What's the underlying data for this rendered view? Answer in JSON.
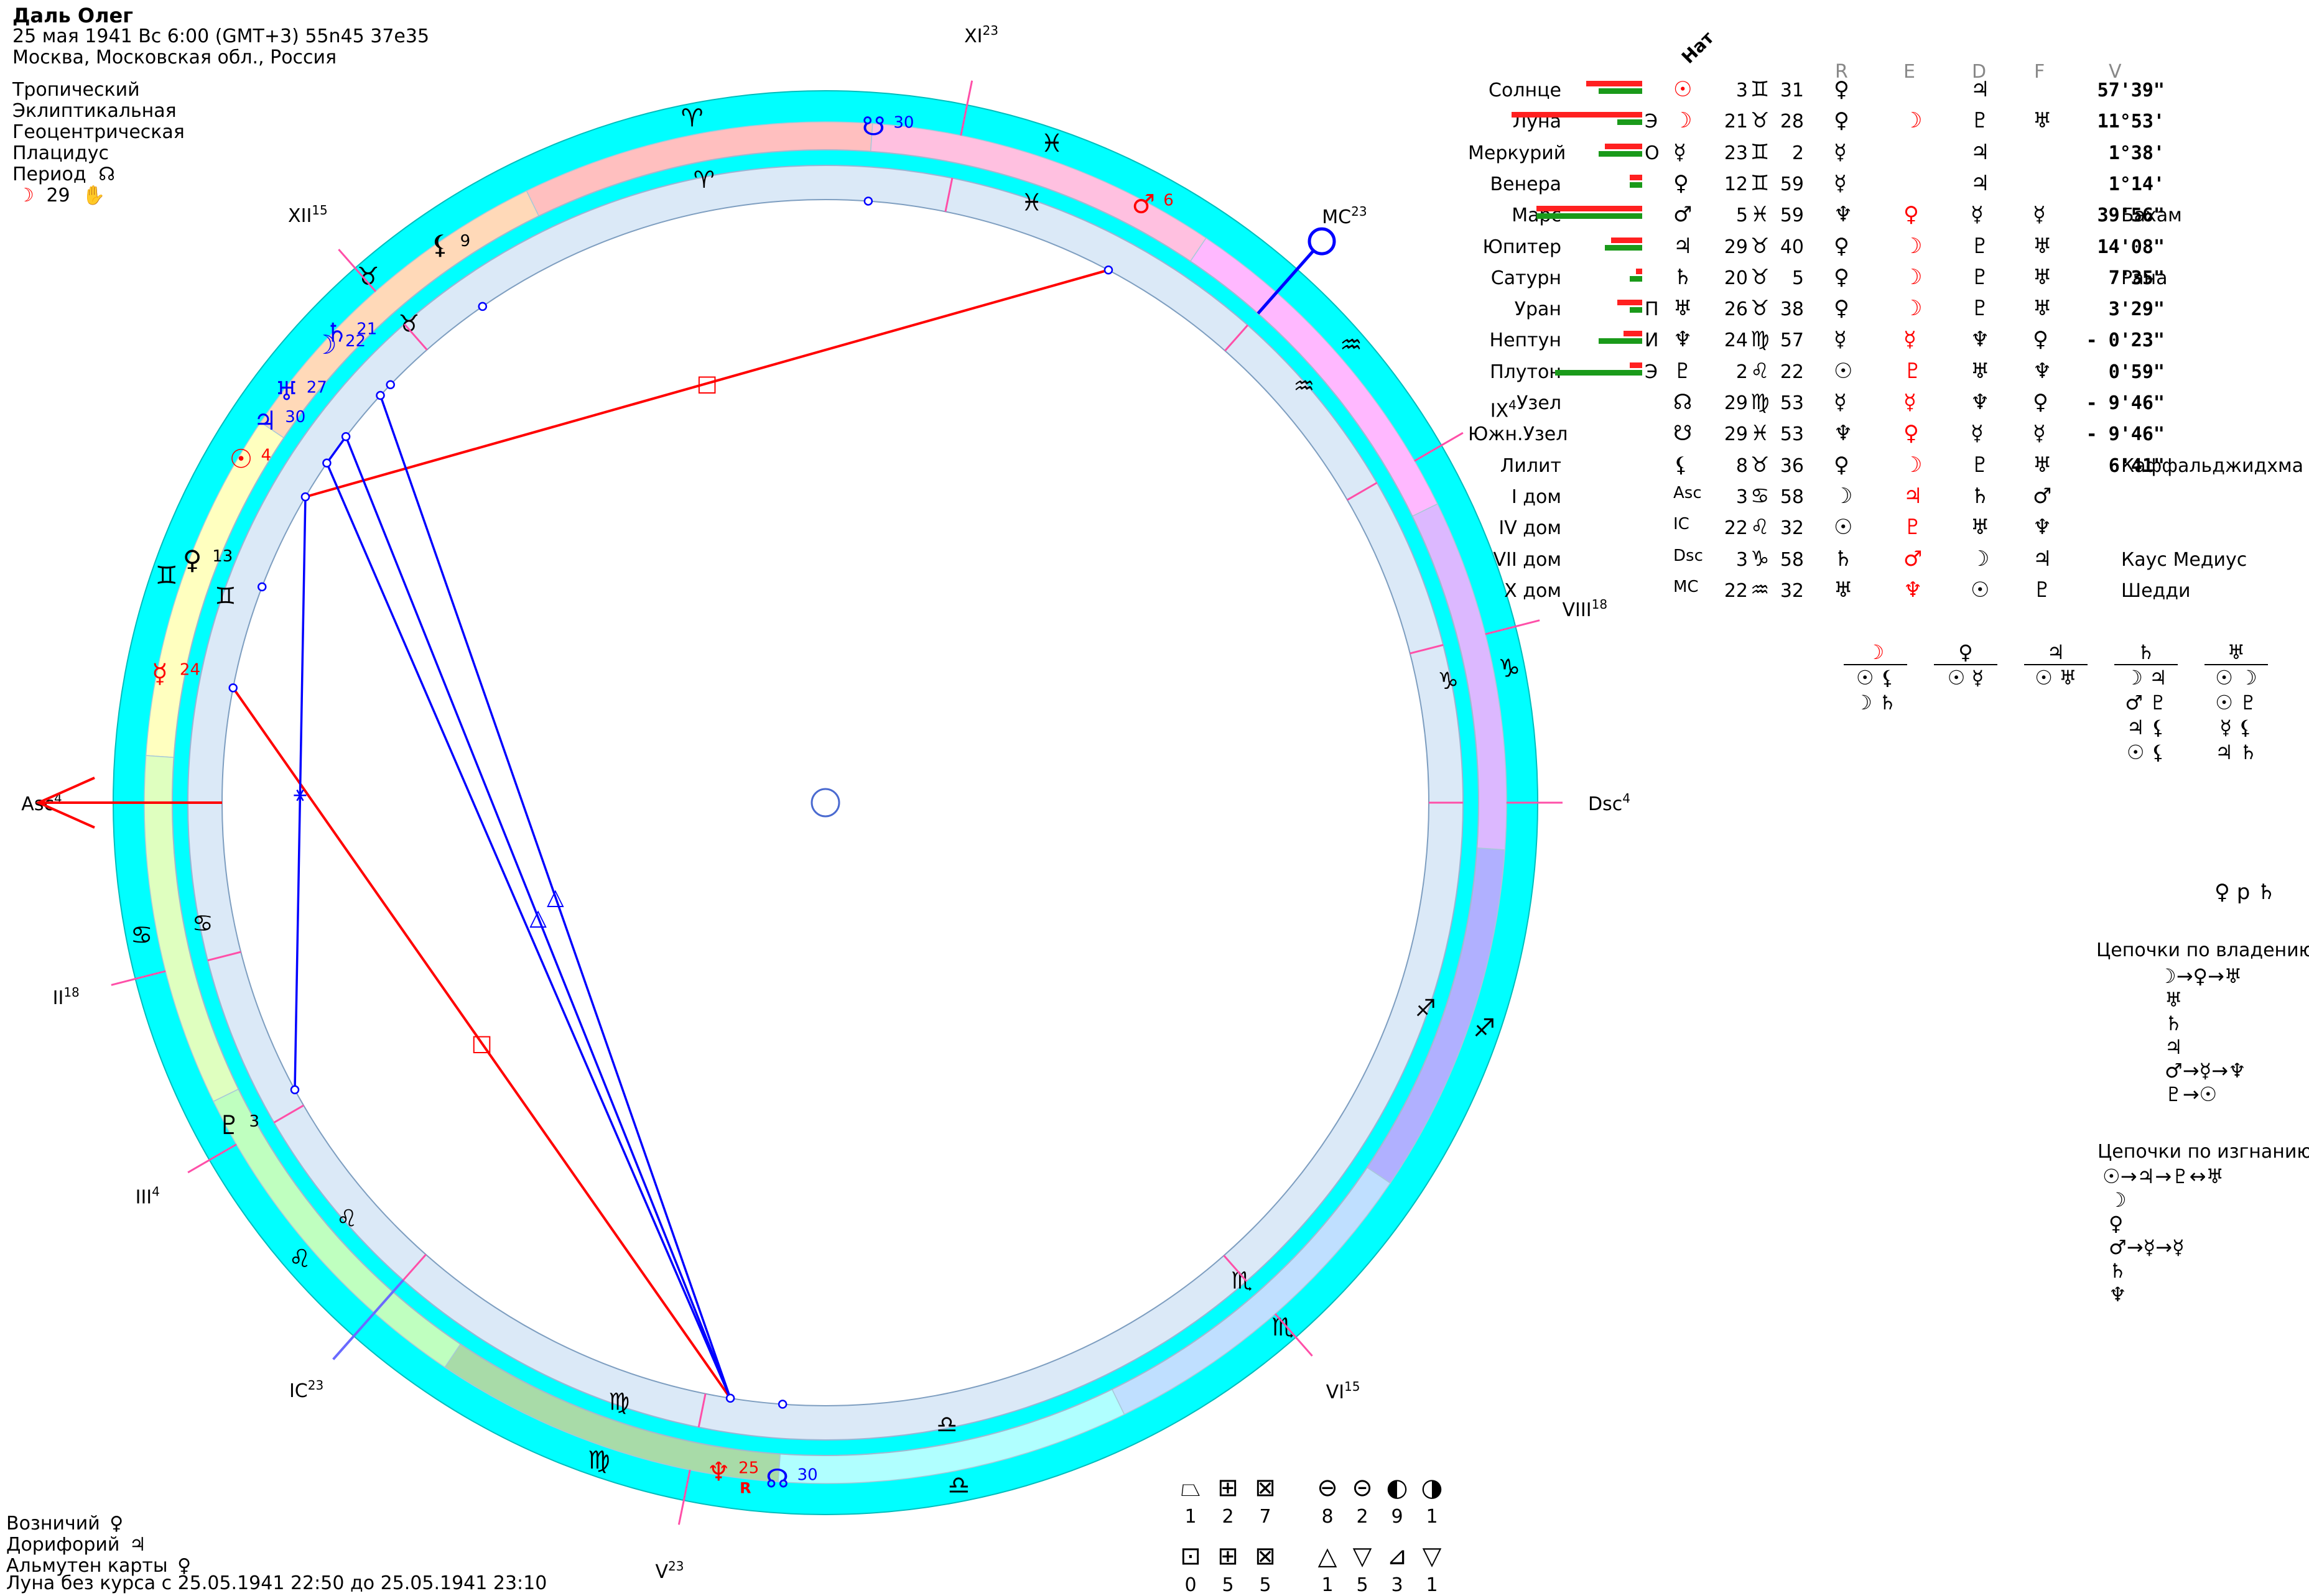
{
  "header": {
    "name": "Даль Олег",
    "line1": "25 мая 1941  Вс   6:00 (GMT+3) 55n45  37e35",
    "line2": "Москва, Московская обл., Россия",
    "settings": [
      "Тропический",
      "Эклиптикальная",
      "Геоцентрическая",
      "Плацидус"
    ],
    "period_label": "Период",
    "period_symbol": "☊",
    "period_moon": "☽",
    "period_value": "29",
    "period_hand": "✋"
  },
  "table": {
    "header_nat": "Нат",
    "col_headers": [
      "R",
      "E",
      "D",
      "F",
      "V"
    ],
    "rows": [
      {
        "name": "Солнце",
        "glyph": "☉",
        "deg": "3",
        "sign": "♊",
        "min": "31",
        "r": "♀",
        "e": "",
        "d": "♃",
        "f": "",
        "v": "57'39\"",
        "note": "",
        "marker": ""
      },
      {
        "name": "Луна",
        "glyph": "☽",
        "deg": "21",
        "sign": "♉",
        "min": "28",
        "r": "♀",
        "e": "☽",
        "d": "♇",
        "f": "♅",
        "v": "11°53'",
        "note": "",
        "marker": "Э"
      },
      {
        "name": "Меркурий",
        "glyph": "☿",
        "deg": "23",
        "sign": "♊",
        "min": "2",
        "r": "☿",
        "e": "",
        "d": "♃",
        "f": "",
        "v": "1°38'",
        "note": "",
        "marker": "О"
      },
      {
        "name": "Венера",
        "glyph": "♀",
        "deg": "12",
        "sign": "♊",
        "min": "59",
        "r": "☿",
        "e": "",
        "d": "♃",
        "f": "",
        "v": "1°14'",
        "note": "",
        "marker": ""
      },
      {
        "name": "Марс",
        "glyph": "♂",
        "deg": "5",
        "sign": "♓",
        "min": "59",
        "r": "♆",
        "e": "♀",
        "d": "☿",
        "f": "☿",
        "v": "39'56\"",
        "note": "Бахам",
        "marker": ""
      },
      {
        "name": "Юпитер",
        "glyph": "♃",
        "deg": "29",
        "sign": "♉",
        "min": "40",
        "r": "♀",
        "e": "☽",
        "d": "♇",
        "f": "♅",
        "v": "14'08\"",
        "note": "",
        "marker": ""
      },
      {
        "name": "Сатурн",
        "glyph": "♄",
        "deg": "20",
        "sign": "♉",
        "min": "5",
        "r": "♀",
        "e": "☽",
        "d": "♇",
        "f": "♅",
        "v": "7'35\"",
        "note": "Рана",
        "marker": ""
      },
      {
        "name": "Уран",
        "glyph": "♅",
        "deg": "26",
        "sign": "♉",
        "min": "38",
        "r": "♀",
        "e": "☽",
        "d": "♇",
        "f": "♅",
        "v": "3'29\"",
        "note": "",
        "marker": "П"
      },
      {
        "name": "Нептун",
        "glyph": "♆",
        "deg": "24",
        "sign": "♍",
        "min": "57",
        "r": "☿",
        "e": "☿",
        "d": "♆",
        "f": "♀",
        "v": "- 0'23\"",
        "note": "",
        "marker": "И"
      },
      {
        "name": "Плутон",
        "glyph": "♇",
        "deg": "2",
        "sign": "♌",
        "min": "22",
        "r": "☉",
        "e": "♇",
        "d": "♅",
        "f": "♆",
        "v": "0'59\"",
        "note": "",
        "marker": "Э"
      },
      {
        "name": "Узел",
        "glyph": "☊",
        "deg": "29",
        "sign": "♍",
        "min": "53",
        "r": "☿",
        "e": "☿",
        "d": "♆",
        "f": "♀",
        "v": "- 9'46\"",
        "note": "",
        "marker": ""
      },
      {
        "name": "Южн.Узел",
        "glyph": "☋",
        "deg": "29",
        "sign": "♓",
        "min": "53",
        "r": "♆",
        "e": "♀",
        "d": "☿",
        "f": "☿",
        "v": "- 9'46\"",
        "note": "",
        "marker": ""
      },
      {
        "name": "Лилит",
        "glyph": "⚸",
        "deg": "8",
        "sign": "♉",
        "min": "36",
        "r": "♀",
        "e": "☽",
        "d": "♇",
        "f": "♅",
        "v": "6'41\"",
        "note": "Каффальджидхма",
        "marker": ""
      },
      {
        "name": "I дом",
        "glyph": "Asc",
        "deg": "3",
        "sign": "♋",
        "min": "58",
        "r": "☽",
        "e": "♃",
        "d": "♄",
        "f": "♂",
        "v": "",
        "note": "",
        "marker": ""
      },
      {
        "name": "IV дом",
        "glyph": "IC",
        "deg": "22",
        "sign": "♌",
        "min": "32",
        "r": "☉",
        "e": "♇",
        "d": "♅",
        "f": "♆",
        "v": "",
        "note": "",
        "marker": ""
      },
      {
        "name": "VII дом",
        "glyph": "Dsc",
        "deg": "3",
        "sign": "♑",
        "min": "58",
        "r": "♄",
        "e": "♂",
        "d": "☽",
        "f": "♃",
        "v": "",
        "note": "Каус Медиус",
        "marker": ""
      },
      {
        "name": "X дом",
        "glyph": "MC",
        "deg": "22",
        "sign": "♒",
        "min": "32",
        "r": "♅",
        "e": "♆",
        "d": "☉",
        "f": "♇",
        "v": "",
        "note": "Шедди",
        "marker": ""
      }
    ]
  },
  "dispositors": [
    {
      "top": "☽",
      "items": [
        "☉ ⚸",
        "☽ ♄"
      ]
    },
    {
      "top": "♀",
      "items": [
        "☉ ☿"
      ]
    },
    {
      "top": "♃",
      "items": [
        "☉ ♅"
      ]
    },
    {
      "top": "♄",
      "items": [
        "☽ ♃",
        "♂ ♇",
        "♃ ⚸",
        "☉ ⚸"
      ]
    },
    {
      "top": "♅",
      "items": [
        "☉ ☽",
        "☉ ♇",
        "☿ ⚸",
        "♃ ♄"
      ]
    }
  ],
  "venus_p_saturn": "♀ p ♄",
  "chains_own": {
    "title": "Цепочки по владению",
    "lines": [
      "☽→♀→♅",
      "♅",
      "♄",
      "♃",
      "♂→☿→♆",
      "♇→☉"
    ]
  },
  "chains_exile": {
    "title": "Цепочки по изгнанию",
    "lines": [
      "☉→♃→♇↔♅",
      "☽",
      "♀",
      "♂→☿→☿",
      "♄",
      "♆"
    ]
  },
  "bottom_left": {
    "lines": [
      {
        "label": "Возничий",
        "symbol": "♀"
      },
      {
        "label": "Дорифорий",
        "symbol": "♃"
      },
      {
        "label": "Альмутен карты",
        "symbol": "♀"
      }
    ],
    "void_moon": "Луна без курса с 25.05.1941 22:50 до 25.05.1941 23:10"
  },
  "counters": {
    "row1": [
      {
        "icon": "⏢",
        "value": "1"
      },
      {
        "icon": "⊞",
        "value": "2"
      },
      {
        "icon": "⊠",
        "value": "7"
      },
      {
        "icon": "⊖",
        "value": "8"
      },
      {
        "icon": "⊝",
        "value": "2"
      },
      {
        "icon": "◐",
        "value": "9"
      },
      {
        "icon": "◑",
        "value": "1"
      }
    ],
    "row2": [
      {
        "icon": "⊡",
        "value": "0"
      },
      {
        "icon": "⊞",
        "value": "5"
      },
      {
        "icon": "⊠",
        "value": "5"
      },
      {
        "icon": "△",
        "value": "1"
      },
      {
        "icon": "▽",
        "value": "5"
      },
      {
        "icon": "⊿",
        "value": "3"
      },
      {
        "icon": "▽",
        "value": "1"
      }
    ]
  },
  "wheel": {
    "asc_longitude": 93.97,
    "signs": [
      {
        "glyph": "♈",
        "color": "#ffbfbf"
      },
      {
        "glyph": "♉",
        "color": "#ffd9b8"
      },
      {
        "glyph": "♊",
        "color": "#ffffbf"
      },
      {
        "glyph": "♋",
        "color": "#dfffbf"
      },
      {
        "glyph": "♌",
        "color": "#bfffbf"
      },
      {
        "glyph": "♍",
        "color": "#a8dba8"
      },
      {
        "glyph": "♎",
        "color": "#b0ffff"
      },
      {
        "glyph": "♏",
        "color": "#bfdfff"
      },
      {
        "glyph": "♐",
        "color": "#b0b0ff"
      },
      {
        "glyph": "♑",
        "color": "#dcb8ff"
      },
      {
        "glyph": "♒",
        "color": "#ffb8ff"
      },
      {
        "glyph": "♓",
        "color": "#ffc0e0"
      }
    ],
    "cusps": [
      {
        "label": "Asc",
        "sup": "4",
        "lon": 93.97
      },
      {
        "label": "II",
        "sup": "18",
        "lon": 108.3
      },
      {
        "label": "III",
        "sup": "4",
        "lon": 124.1
      },
      {
        "label": "IC",
        "sup": "23",
        "lon": 142.5
      },
      {
        "label": "V",
        "sup": "23",
        "lon": 172.5
      },
      {
        "label": "VI",
        "sup": "15",
        "lon": 225.3
      },
      {
        "label": "Dsc",
        "sup": "4",
        "lon": 273.97
      },
      {
        "label": "VIII",
        "sup": "18",
        "lon": 288.3
      },
      {
        "label": "IX",
        "sup": "4",
        "lon": 304.1
      },
      {
        "label": "MC",
        "sup": "23",
        "lon": 322.5
      },
      {
        "label": "XI",
        "sup": "23",
        "lon": 352.5
      },
      {
        "label": "XII",
        "sup": "15",
        "lon": 45.3
      }
    ],
    "planets": [
      {
        "glyph": "☉",
        "deg": "4",
        "lon": 63.5,
        "color": "#ff0000"
      },
      {
        "glyph": "☽",
        "deg": "22",
        "lon": 51.5,
        "color": "#0000ff"
      },
      {
        "glyph": "☿",
        "deg": "24",
        "lon": 83.0,
        "color": "#ff0000"
      },
      {
        "glyph": "♀",
        "deg": "13",
        "lon": 73.0,
        "color": "#000000"
      },
      {
        "glyph": "♂",
        "deg": "6",
        "lon": 336.0,
        "color": "#ff0000"
      },
      {
        "glyph": "♃",
        "deg": "30",
        "lon": 59.7,
        "color": "#0000ff"
      },
      {
        "glyph": "♄",
        "deg": "21",
        "lon": 50.1,
        "color": "#0000ff"
      },
      {
        "glyph": "♅",
        "deg": "27",
        "lon": 56.6,
        "color": "#0000ff"
      },
      {
        "glyph": "♆",
        "deg": "25",
        "lon": 174.9,
        "color": "#ff0000",
        "retro": "R"
      },
      {
        "glyph": "♇",
        "deg": "3",
        "lon": 122.4,
        "color": "#000000"
      },
      {
        "glyph": "☊",
        "deg": "30",
        "lon": 179.9,
        "color": "#0000ff"
      },
      {
        "glyph": "☋",
        "deg": "30",
        "lon": 359.9,
        "color": "#0000ff"
      },
      {
        "glyph": "⚸",
        "deg": "9",
        "lon": 38.6,
        "color": "#000000"
      }
    ],
    "aspects": [
      {
        "a": 83.0,
        "b": 174.9,
        "color": "#ff0000",
        "mark": "□"
      },
      {
        "a": 63.5,
        "b": 336.0,
        "color": "#ff0000",
        "mark": "□"
      },
      {
        "a": 63.5,
        "b": 122.4,
        "color": "#0000ff",
        "mark": "⚹"
      },
      {
        "a": 59.7,
        "b": 174.9,
        "color": "#0000ff",
        "mark": ""
      },
      {
        "a": 56.6,
        "b": 174.9,
        "color": "#0000ff",
        "mark": "△"
      },
      {
        "a": 51.5,
        "b": 174.9,
        "color": "#0000ff",
        "mark": "△"
      },
      {
        "a": 59.7,
        "b": 56.6,
        "color": "#0000ff",
        "mark": ""
      }
    ]
  }
}
